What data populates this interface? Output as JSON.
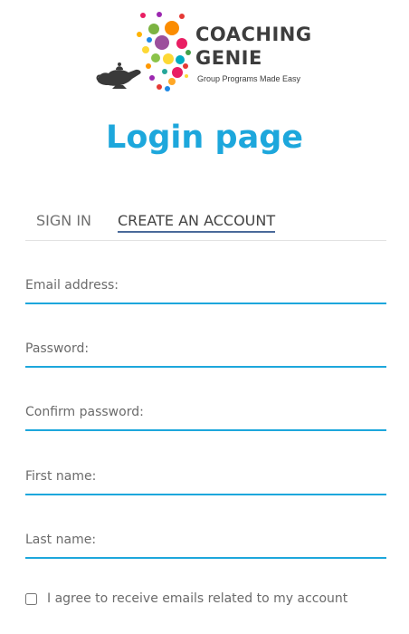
{
  "brand": {
    "name_line1": "COACHING",
    "name_line2": "GENIE",
    "tagline": "Group Programs Made Easy"
  },
  "page": {
    "title": "Login page"
  },
  "tabs": [
    {
      "label": "SIGN IN",
      "active": false
    },
    {
      "label": "CREATE AN ACCOUNT",
      "active": true
    }
  ],
  "form": {
    "email": {
      "placeholder": "Email address:",
      "value": ""
    },
    "password": {
      "placeholder": "Password:",
      "value": ""
    },
    "confirm_password": {
      "placeholder": "Confirm password:",
      "value": ""
    },
    "first_name": {
      "placeholder": "First name:",
      "value": ""
    },
    "last_name": {
      "placeholder": "Last name:",
      "value": ""
    },
    "agree": {
      "label": "I agree to receive emails related to my account",
      "checked": false
    }
  },
  "colors": {
    "accent": "#1da7dc",
    "tab_underline": "#4a6a9a",
    "brand_text": "#3d3d3d"
  },
  "icons": [
    "genie-lamp-logo-icon",
    "confetti-dots-icon"
  ]
}
